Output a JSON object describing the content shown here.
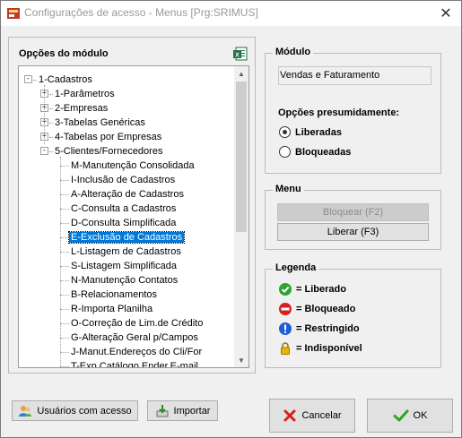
{
  "window": {
    "title": "Configurações de acesso - Menus [Prg:SRIMUS]"
  },
  "left": {
    "title": "Opções do módulo",
    "tree": [
      {
        "label": "1-Cadastros",
        "level": 0,
        "expander": "-"
      },
      {
        "label": "1-Parâmetros",
        "level": 1,
        "expander": "+"
      },
      {
        "label": "2-Empresas",
        "level": 1,
        "expander": "+"
      },
      {
        "label": "3-Tabelas Genéricas",
        "level": 1,
        "expander": "+"
      },
      {
        "label": "4-Tabelas por Empresas",
        "level": 1,
        "expander": "+"
      },
      {
        "label": "5-Clientes/Fornecedores",
        "level": 1,
        "expander": "-"
      },
      {
        "label": "M-Manutenção Consolidada",
        "level": 2
      },
      {
        "label": "I-Inclusão de Cadastros",
        "level": 2
      },
      {
        "label": "A-Alteração de Cadastros",
        "level": 2
      },
      {
        "label": "C-Consulta a Cadastros",
        "level": 2
      },
      {
        "label": "D-Consulta Simplificada",
        "level": 2
      },
      {
        "label": "E-Exclusão de Cadastros",
        "level": 2,
        "selected": true
      },
      {
        "label": "L-Listagem de Cadastros",
        "level": 2
      },
      {
        "label": "S-Listagem Simplificada",
        "level": 2
      },
      {
        "label": "N-Manutenção Contatos",
        "level": 2
      },
      {
        "label": "B-Relacionamentos",
        "level": 2
      },
      {
        "label": "R-Importa Planilha",
        "level": 2
      },
      {
        "label": "O-Correção de Lim.de Crédito",
        "level": 2
      },
      {
        "label": "G-Alteração Geral p/Campos",
        "level": 2
      },
      {
        "label": "J-Manut.Endereços do Cli/For",
        "level": 2
      },
      {
        "label": "T-Exp.Catálogo Ender.E-mail",
        "level": 2
      }
    ]
  },
  "modulo": {
    "title": "Módulo",
    "value": "Vendas e Faturamento",
    "options_heading": "Opções presumidamente:",
    "radio_liberadas": "Liberadas",
    "radio_bloqueadas": "Bloqueadas",
    "selected": "Liberadas"
  },
  "menu": {
    "title": "Menu",
    "bloquear_label": "Bloquear (F2)",
    "liberar_label": "Liberar (F3)"
  },
  "legenda": {
    "title": "Legenda",
    "items": [
      {
        "text": "= Liberado",
        "color": "#2ea32e"
      },
      {
        "text": "= Bloqueado",
        "color": "#d42020"
      },
      {
        "text": "= Restringido",
        "color": "#1e5fd6"
      },
      {
        "text": "= Indisponível",
        "color": "#d9a400"
      }
    ]
  },
  "buttons": {
    "usuarios": "Usuários com acesso",
    "importar": "Importar",
    "cancelar": "Cancelar",
    "ok": "OK"
  }
}
